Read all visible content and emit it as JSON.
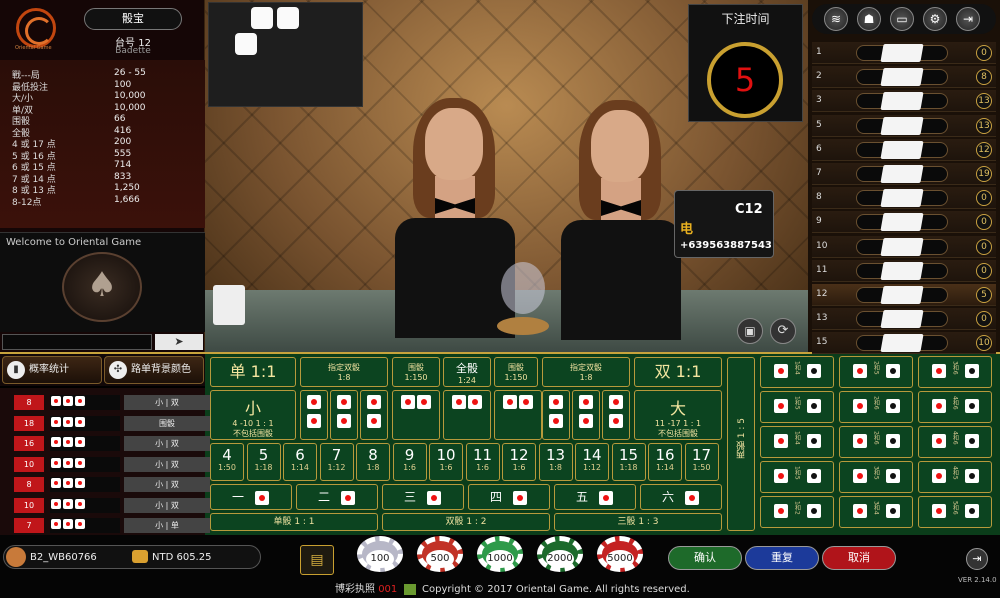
{
  "header": {
    "game_title": "骰宝",
    "table_no": "台号 12",
    "dealer": "Badette",
    "logo_text": "Oriental Game"
  },
  "limits": [
    {
      "k": "戰---局",
      "v": "26 - 55"
    },
    {
      "k": "最低投注",
      "v": "100"
    },
    {
      "k": "大/小",
      "v": "10,000"
    },
    {
      "k": "单/双",
      "v": "10,000"
    },
    {
      "k": "围骰",
      "v": "66"
    },
    {
      "k": "全骰",
      "v": "416"
    },
    {
      "k": "4 或 17 点",
      "v": "200"
    },
    {
      "k": "5 或 16 点",
      "v": "555"
    },
    {
      "k": "6 或 15 点",
      "v": "714"
    },
    {
      "k": "7 或 14 点",
      "v": "833"
    },
    {
      "k": "8 或 13 点",
      "v": "1,250"
    },
    {
      "k": "8-12点",
      "v": "1,666"
    }
  ],
  "welcome": "Welcome to Oriental Game",
  "chat": {
    "send": "➤"
  },
  "timer": {
    "label": "下注时间",
    "value": "5"
  },
  "sign": {
    "code": "C12",
    "char": "电",
    "tel": "+639563887543"
  },
  "toolbar": [
    "wifi-icon",
    "person-icon",
    "monitor-icon",
    "gear-icon",
    "exit-icon"
  ],
  "history": [
    {
      "n": "1",
      "cnt": "0"
    },
    {
      "n": "2",
      "cnt": "8"
    },
    {
      "n": "3",
      "cnt": "13"
    },
    {
      "n": "5",
      "cnt": "13"
    },
    {
      "n": "6",
      "cnt": "12"
    },
    {
      "n": "7",
      "cnt": "19"
    },
    {
      "n": "8",
      "cnt": "0"
    },
    {
      "n": "9",
      "cnt": "0"
    },
    {
      "n": "10",
      "cnt": "0"
    },
    {
      "n": "11",
      "cnt": "0"
    },
    {
      "n": "12",
      "cnt": "5"
    },
    {
      "n": "13",
      "cnt": "0"
    },
    {
      "n": "15",
      "cnt": "10"
    }
  ],
  "stats_header": {
    "prob": "概率统计",
    "bg": "路单背景颜色"
  },
  "stats": [
    {
      "num": "8",
      "res": "小 | 双"
    },
    {
      "num": "18",
      "res": "围骰"
    },
    {
      "num": "16",
      "res": "小 | 双"
    },
    {
      "num": "10",
      "res": "小 | 双"
    },
    {
      "num": "8",
      "res": "小 | 双"
    },
    {
      "num": "10",
      "res": "小 | 双"
    },
    {
      "num": "7",
      "res": "小 | 单"
    }
  ],
  "bets": {
    "single": "单 1:1",
    "double": "双 1:1",
    "specific_double": "指定双骰",
    "specific_double_odds": "1:8",
    "triple": "围骰",
    "triple_odds": "1:150",
    "any_triple": "全骰",
    "any_triple_odds": "1:24",
    "small": "小",
    "small_desc1": "4 -10 1 : 1",
    "small_desc2": "不包括围骰",
    "big": "大",
    "big_desc1": "11 -17 1 : 1",
    "big_desc2": "不包括围骰",
    "two_dice": "两骰 1 : 5",
    "sums": [
      {
        "s": "4",
        "o": "1:50"
      },
      {
        "s": "5",
        "o": "1:18"
      },
      {
        "s": "6",
        "o": "1:14"
      },
      {
        "s": "7",
        "o": "1:12"
      },
      {
        "s": "8",
        "o": "1:8"
      },
      {
        "s": "9",
        "o": "1:6"
      },
      {
        "s": "10",
        "o": "1:6"
      },
      {
        "s": "11",
        "o": "1:6"
      },
      {
        "s": "12",
        "o": "1:6"
      },
      {
        "s": "13",
        "o": "1:8"
      },
      {
        "s": "14",
        "o": "1:12"
      },
      {
        "s": "15",
        "o": "1:18"
      },
      {
        "s": "16",
        "o": "1:14"
      },
      {
        "s": "17",
        "o": "1:50"
      }
    ],
    "singles": [
      "一",
      "二",
      "三",
      "四",
      "五",
      "六"
    ],
    "single_die": "单骰 1 : 1",
    "double_die": "双骰 1 : 2",
    "triple_die": "三骰 1 : 3",
    "pair_labels": [
      [
        "1和4",
        "2和5",
        "3和6"
      ],
      [
        "1和5",
        "2和6",
        "4和6"
      ],
      [
        "1和4",
        "2和6",
        "4和6"
      ],
      [
        "1和5",
        "3和5",
        "4和5"
      ],
      [
        "1和2",
        "3和4",
        "5和6"
      ]
    ]
  },
  "user": {
    "name": "B2_WB60766",
    "balance": "NTD 605.25"
  },
  "chips": [
    {
      "v": "100",
      "color": "#b7b7c7"
    },
    {
      "v": "500",
      "color": "#c23226"
    },
    {
      "v": "1000",
      "color": "#2e9a4a"
    },
    {
      "v": "2000",
      "color": "#1c6a2c"
    },
    {
      "v": "5000",
      "color": "#c42222"
    }
  ],
  "actions": {
    "confirm": "确认",
    "repeat": "重复",
    "cancel": "取消"
  },
  "footer": {
    "license": "博彩执照",
    "license_no": "001",
    "copyright": "Copyright © 2017 Oriental Game. All rights reserved."
  },
  "version": "VER 2.14.0"
}
